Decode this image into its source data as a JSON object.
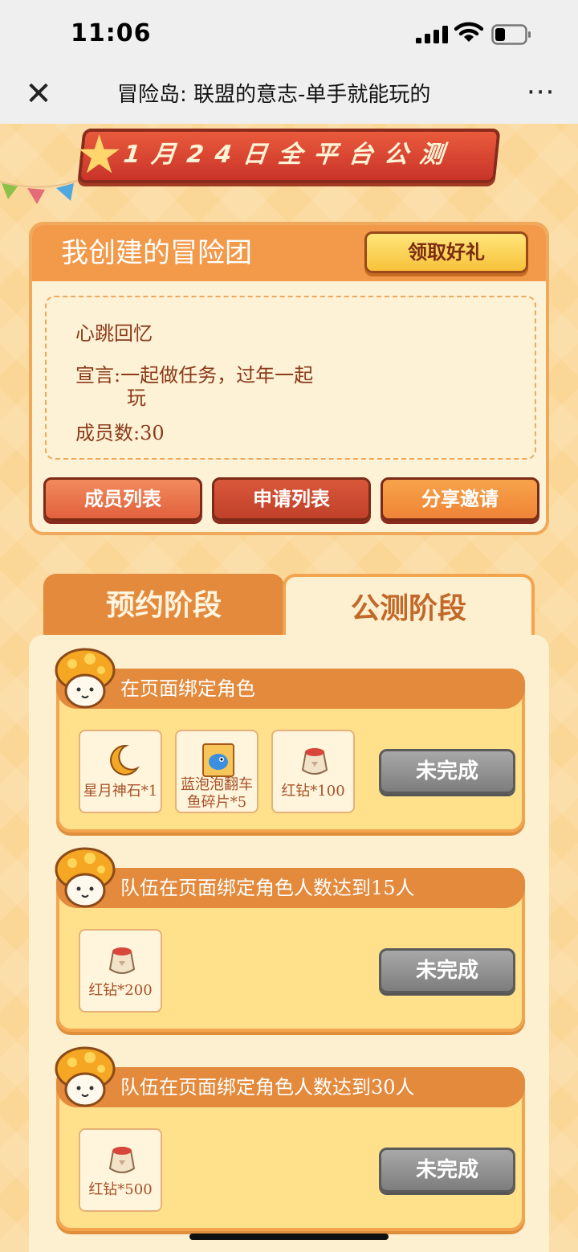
{
  "status_bar": {
    "time": "11:06"
  },
  "nav": {
    "title": "冒险岛: 联盟的意志-单手就能玩的"
  },
  "banner": {
    "text": "1月24日全平台公测"
  },
  "team_card": {
    "title": "我创建的冒险团",
    "gift_button": "领取好礼",
    "team_name": "心跳回忆",
    "declaration_line1": "宣言:一起做任务，过年一起",
    "declaration_line2": "玩",
    "member_count": "成员数:30",
    "buttons": [
      "成员列表",
      "申请列表",
      "分享邀请"
    ]
  },
  "tabs": [
    {
      "label": "预约阶段",
      "active": false
    },
    {
      "label": "公测阶段",
      "active": true
    }
  ],
  "tasks": [
    {
      "title": "在页面绑定角色",
      "rewards": [
        {
          "icon": "moon-stone-icon",
          "label": "星月神石*1"
        },
        {
          "icon": "blue-fish-card-icon",
          "label_line1": "蓝泡泡翻车",
          "label_line2": "鱼碎片*5"
        },
        {
          "icon": "red-diamond-bag-icon",
          "label": "红钻*100"
        }
      ],
      "status": "未完成"
    },
    {
      "title": "队伍在页面绑定角色人数达到15人",
      "rewards": [
        {
          "icon": "red-diamond-bag-icon",
          "label": "红钻*200"
        }
      ],
      "status": "未完成"
    },
    {
      "title": "队伍在页面绑定角色人数达到30人",
      "rewards": [
        {
          "icon": "red-diamond-bag-icon",
          "label": "红钻*500"
        }
      ],
      "status": "未完成"
    }
  ],
  "colors": {
    "accent": "#f2994a",
    "tab_inactive": "#e38a3c",
    "status_gray": "#8a8a8a"
  }
}
